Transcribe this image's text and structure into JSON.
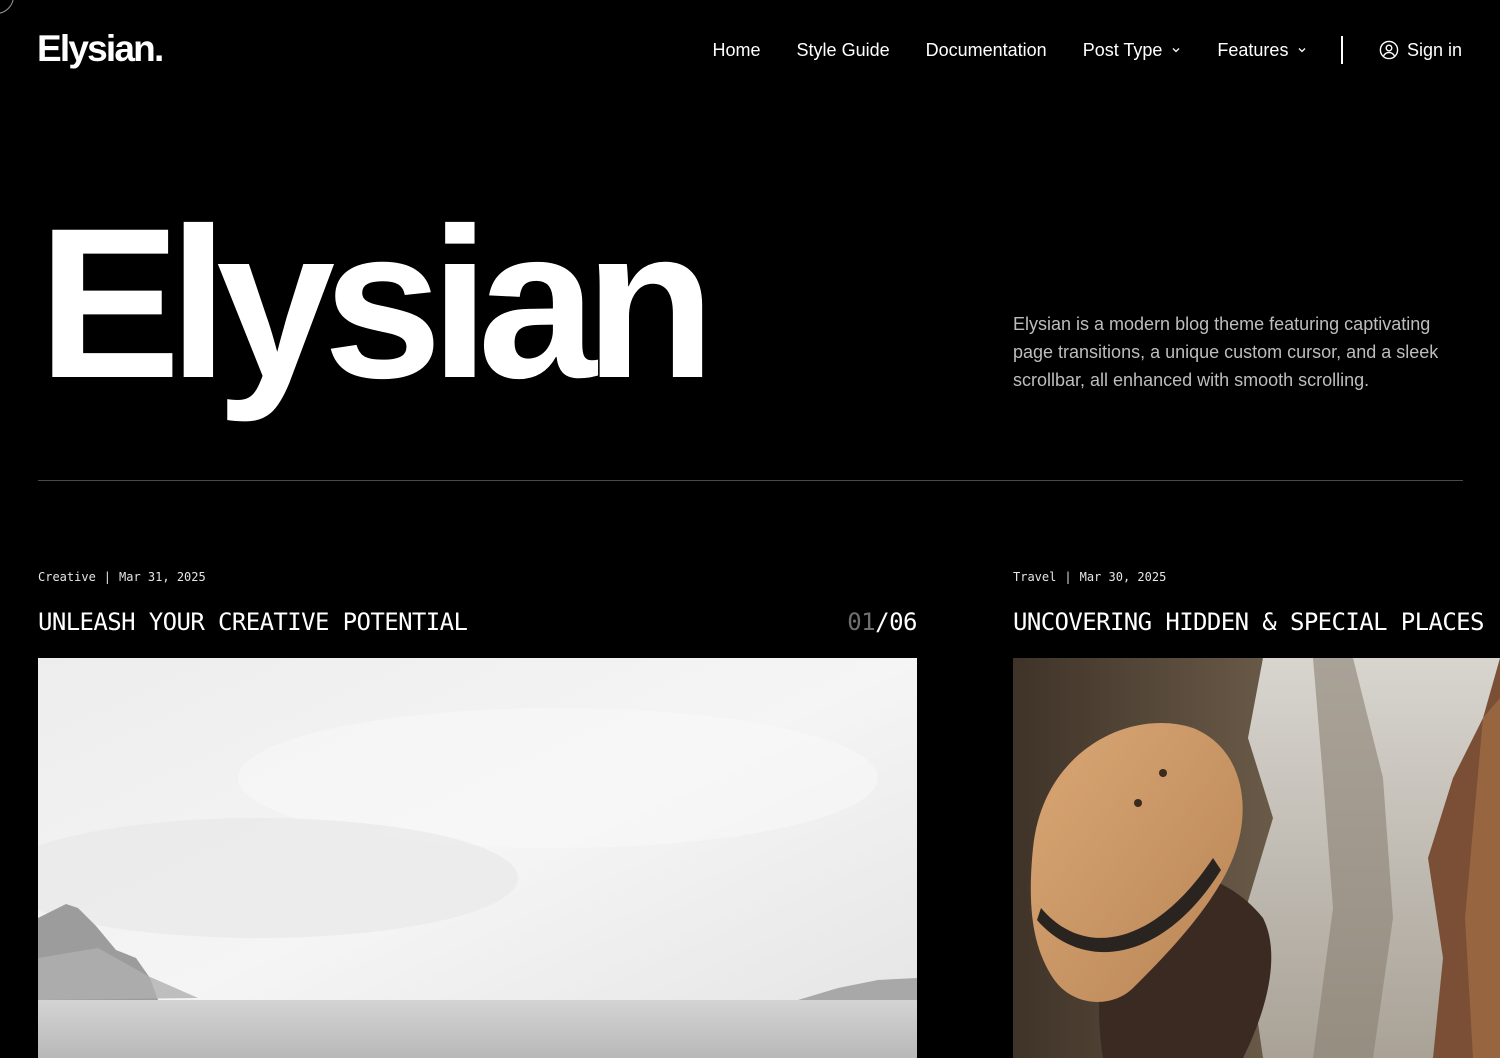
{
  "header": {
    "logo": "Elysian.",
    "nav": [
      {
        "label": "Home",
        "has_dropdown": false
      },
      {
        "label": "Style Guide",
        "has_dropdown": false
      },
      {
        "label": "Documentation",
        "has_dropdown": false
      },
      {
        "label": "Post Type",
        "has_dropdown": true
      },
      {
        "label": "Features",
        "has_dropdown": true
      }
    ],
    "signin_label": "Sign in",
    "signin_icon": "user-circle-icon"
  },
  "hero": {
    "title": "Elysian",
    "description": "Elysian is a modern blog theme featuring captivating page transitions, a unique custom cursor, and a sleek scrollbar, all enhanced with smooth scrolling."
  },
  "posts": [
    {
      "category": "Creative",
      "separator": "|",
      "date": "Mar 31, 2025",
      "title": "UNLEASH YOUR CREATIVE POTENTIAL",
      "counter_current": "01",
      "counter_total": "/06",
      "image": "misty-mountains-grayscale"
    },
    {
      "category": "Travel",
      "separator": "|",
      "date": "Mar 30, 2025",
      "title": "UNCOVERING HIDDEN & SPECIAL PLACES",
      "image": "traveler-hat-canyon"
    }
  ],
  "colors": {
    "background": "#000000",
    "text": "#ffffff",
    "muted_text": "#bdbdbd",
    "divider": "#4a4a4a",
    "counter_muted": "#6f6f6f"
  }
}
